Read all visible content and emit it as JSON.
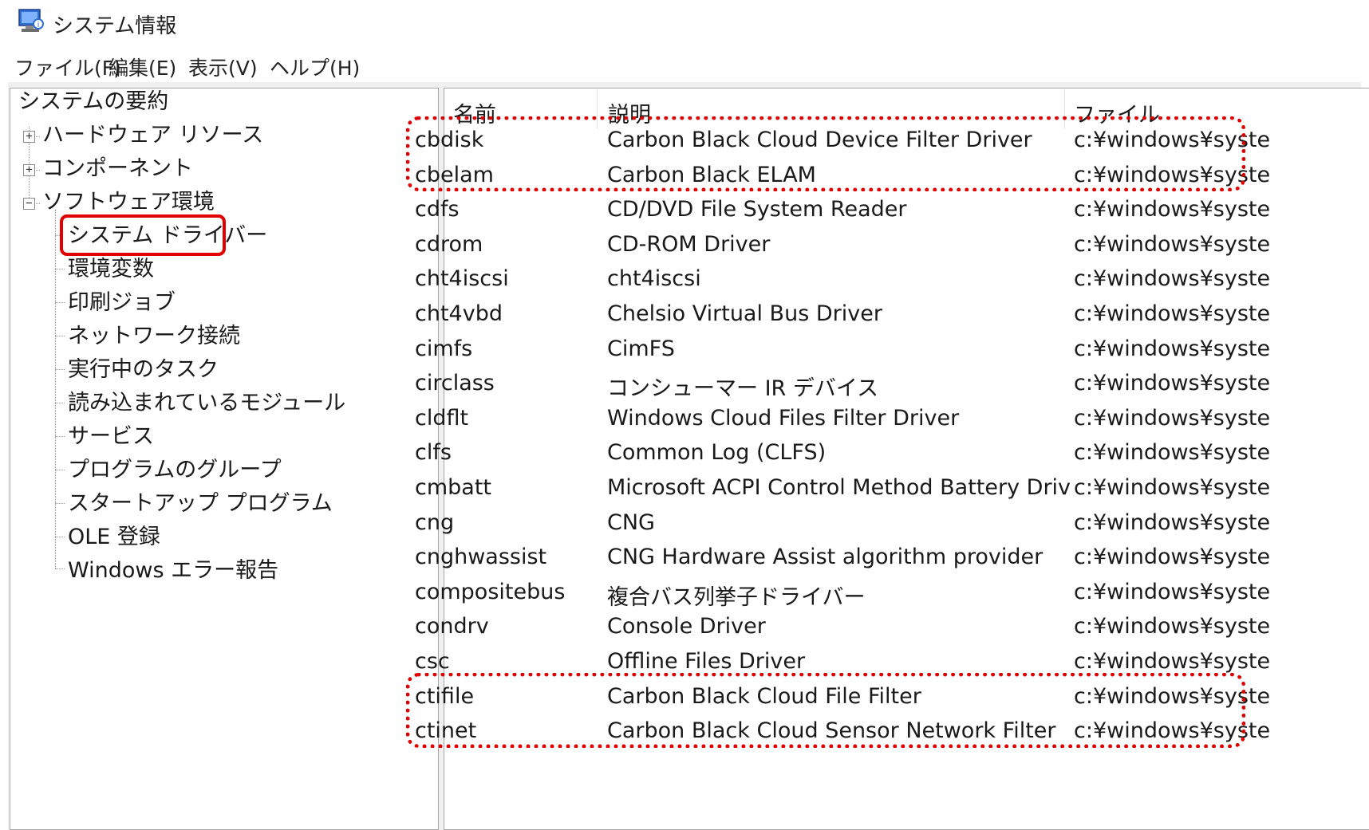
{
  "window": {
    "title": "システム情報",
    "icon": "system-information-icon"
  },
  "menu": [
    "ファイル(F)",
    "編集(E)",
    "表示(V)",
    "ヘルプ(H)"
  ],
  "tree": {
    "root": "システムの要約",
    "nodes": [
      {
        "label": "ハードウェア リソース",
        "expander": "+"
      },
      {
        "label": "コンポーネント",
        "expander": "+"
      },
      {
        "label": "ソフトウェア環境",
        "expander": "−"
      }
    ],
    "children": [
      "システム ドライバー",
      "環境変数",
      "印刷ジョブ",
      "ネットワーク接続",
      "実行中のタスク",
      "読み込まれているモジュール",
      "サービス",
      "プログラムのグループ",
      "スタートアップ プログラム",
      "OLE 登録",
      "Windows エラー報告"
    ],
    "selected": "システム ドライバー"
  },
  "table": {
    "columns": [
      "名前",
      "説明",
      "ファイル"
    ],
    "rows": [
      {
        "name": "cbdisk",
        "desc": "Carbon Black Cloud Device Filter Driver",
        "file": "c:¥windows¥syste"
      },
      {
        "name": "cbelam",
        "desc": "Carbon Black ELAM",
        "file": "c:¥windows¥syste"
      },
      {
        "name": "cdfs",
        "desc": "CD/DVD File System Reader",
        "file": "c:¥windows¥syste"
      },
      {
        "name": "cdrom",
        "desc": "CD-ROM Driver",
        "file": "c:¥windows¥syste"
      },
      {
        "name": "cht4iscsi",
        "desc": "cht4iscsi",
        "file": "c:¥windows¥syste"
      },
      {
        "name": "cht4vbd",
        "desc": "Chelsio Virtual Bus Driver",
        "file": "c:¥windows¥syste"
      },
      {
        "name": "cimfs",
        "desc": "CimFS",
        "file": "c:¥windows¥syste"
      },
      {
        "name": "circlass",
        "desc": "コンシューマー IR デバイス",
        "file": "c:¥windows¥syste"
      },
      {
        "name": "cldflt",
        "desc": "Windows Cloud Files Filter Driver",
        "file": "c:¥windows¥syste"
      },
      {
        "name": "clfs",
        "desc": "Common Log (CLFS)",
        "file": "c:¥windows¥syste"
      },
      {
        "name": "cmbatt",
        "desc": "Microsoft ACPI Control Method Battery Driver",
        "file": "c:¥windows¥syste"
      },
      {
        "name": "cng",
        "desc": "CNG",
        "file": "c:¥windows¥syste"
      },
      {
        "name": "cnghwassist",
        "desc": "CNG Hardware Assist algorithm provider",
        "file": "c:¥windows¥syste"
      },
      {
        "name": "compositebus",
        "desc": "複合バス列挙子ドライバー",
        "file": "c:¥windows¥syste"
      },
      {
        "name": "condrv",
        "desc": "Console Driver",
        "file": "c:¥windows¥syste"
      },
      {
        "name": "csc",
        "desc": "Offline Files Driver",
        "file": "c:¥windows¥syste"
      },
      {
        "name": "ctifile",
        "desc": "Carbon Black Cloud File Filter",
        "file": "c:¥windows¥syste"
      },
      {
        "name": "ctinet",
        "desc": "Carbon Black Cloud Sensor Network Filter",
        "file": "c:¥windows¥syste"
      }
    ]
  },
  "highlight_color": "#e00000"
}
